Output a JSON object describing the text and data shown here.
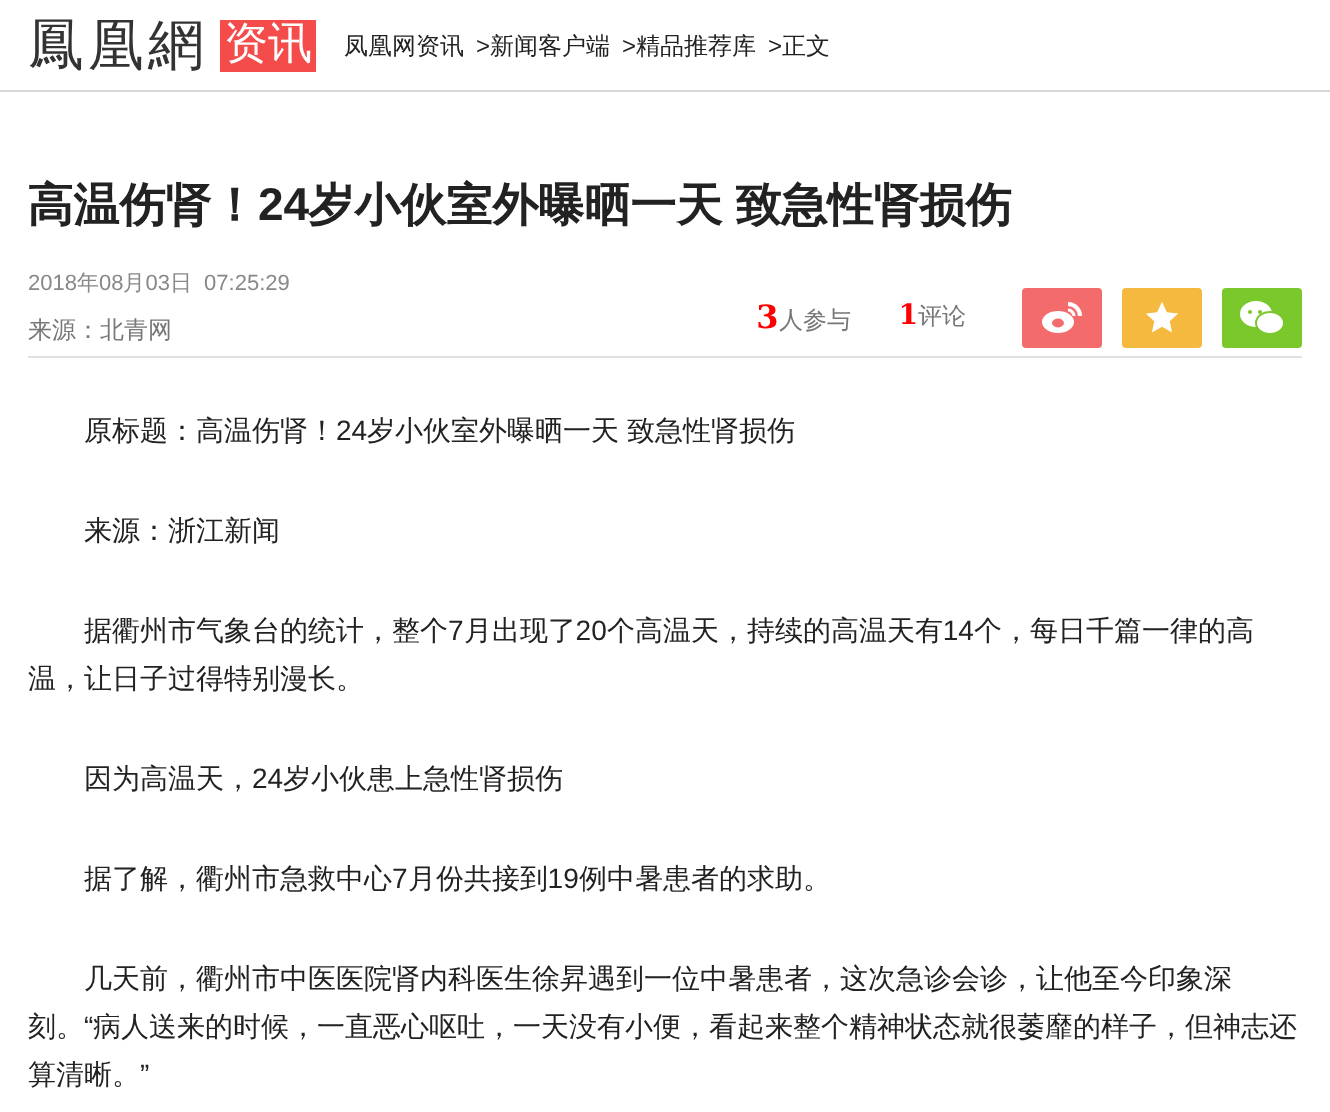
{
  "header": {
    "logo": "鳳凰網",
    "section_badge": "资讯",
    "breadcrumbs": [
      "凤凰网资讯",
      ">新闻客户端",
      ">精品推荐库",
      ">正文"
    ]
  },
  "article": {
    "title": "高温伤肾！24岁小伙室外曝晒一天 致急性肾损伤",
    "datetime": "2018年08月03日  07:25:29",
    "source": "来源：北青网",
    "participants": {
      "count": "3",
      "label": "人参与"
    },
    "comments": {
      "count": "1",
      "label": "评论"
    },
    "share_buttons": [
      {
        "kind": "weibo",
        "color": "#f46b6b"
      },
      {
        "kind": "favorite",
        "color": "#f5b940"
      },
      {
        "kind": "wechat",
        "color": "#7ac82c"
      }
    ],
    "paragraphs": [
      "原标题：高温伤肾！24岁小伙室外曝晒一天 致急性肾损伤",
      "来源：浙江新闻",
      "据衢州市气象台的统计，整个7月出现了20个高温天，持续的高温天有14个，每日千篇一律的高温，让日子过得特别漫长。",
      "因为高温天，24岁小伙患上急性肾损伤",
      "据了解，衢州市急救中心7月份共接到19例中暑患者的求助。",
      "几天前，衢州市中医医院肾内科医生徐昇遇到一位中暑患者，这次急诊会诊，让他至今印象深刻。“病人送来的时候，一直恶心呕吐，一天没有小便，看起来整个精神状态就很萎靡的样子，但神志还算清晰。”"
    ]
  }
}
